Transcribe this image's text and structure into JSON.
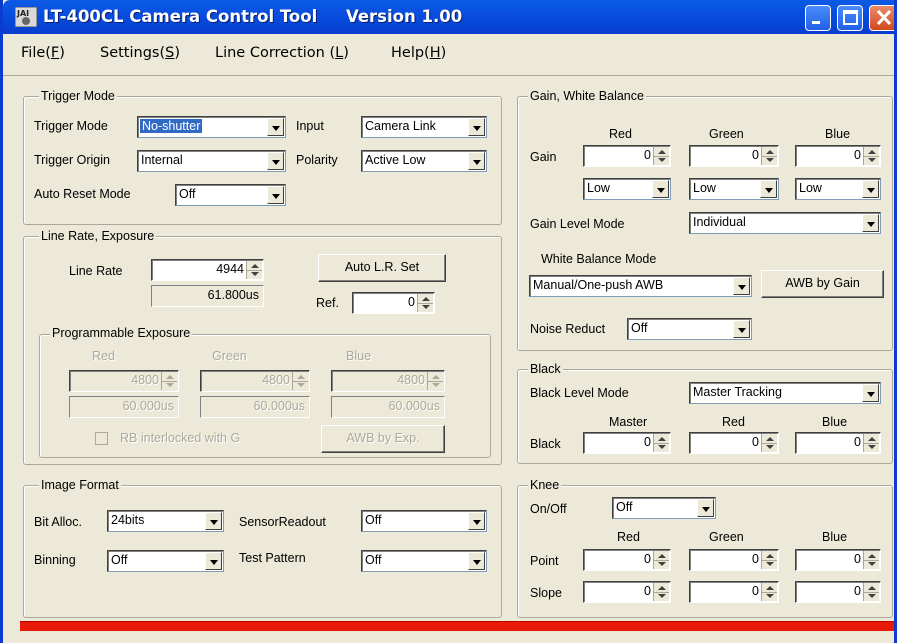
{
  "window": {
    "title": "LT-400CL Camera Control Tool     Version 1.00"
  },
  "menu": [
    {
      "text": "File(",
      "key": "F",
      "end": ")"
    },
    {
      "text": "Settings(",
      "key": "S",
      "end": ")"
    },
    {
      "text": "Line Correction (",
      "key": "L",
      "end": ")"
    },
    {
      "text": "Help(",
      "key": "H",
      "end": ")"
    }
  ],
  "trigger": {
    "title": "Trigger Mode",
    "mode_label": "Trigger Mode",
    "mode_value": "No-shutter",
    "input_label": "Input",
    "input_value": "Camera Link",
    "origin_label": "Trigger Origin",
    "origin_value": "Internal",
    "polarity_label": "Polarity",
    "polarity_value": "Active Low",
    "reset_label": "Auto Reset Mode",
    "reset_value": "Off"
  },
  "line_rate": {
    "title": "Line Rate, Exposure",
    "rate_label": "Line Rate",
    "rate_value": "4944",
    "rate_time": "61.800us",
    "auto_button": "Auto L.R. Set",
    "ref_label": "Ref.",
    "ref_value": "0"
  },
  "prog_exposure": {
    "title": "Programmable Exposure",
    "red_label": "Red",
    "green_label": "Green",
    "blue_label": "Blue",
    "red_value": "4800",
    "green_value": "4800",
    "blue_value": "4800",
    "red_time": "60.000us",
    "green_time": "60.000us",
    "blue_time": "60.000us",
    "interlock_label": "RB interlocked with G",
    "awb_button": "AWB by Exp."
  },
  "image_format": {
    "title": "Image Format",
    "bit_label": "Bit Alloc.",
    "bit_value": "24bits",
    "sensor_label": "SensorReadout",
    "sensor_value": "Off",
    "binning_label": "Binning",
    "binning_value": "Off",
    "test_label": "Test Pattern",
    "test_value": "Off"
  },
  "gain": {
    "title": "Gain, White Balance",
    "red_label": "Red",
    "green_label": "Green",
    "blue_label": "Blue",
    "gain_label": "Gain",
    "red_value": "0",
    "green_value": "0",
    "blue_value": "0",
    "red_range": "Low",
    "green_range": "Low",
    "blue_range": "Low",
    "level_mode_label": "Gain Level Mode",
    "level_mode_value": "Individual",
    "wb_mode_label": "White Balance Mode",
    "wb_mode_value": "Manual/One-push AWB",
    "awb_button": "AWB by Gain",
    "noise_label": "Noise Reduct",
    "noise_value": "Off"
  },
  "black": {
    "title": "Black",
    "mode_label": "Black Level Mode",
    "mode_value": "Master Tracking",
    "master_label": "Master",
    "red_label": "Red",
    "blue_label": "Blue",
    "row_label": "Black",
    "master_value": "0",
    "red_value": "0",
    "blue_value": "0"
  },
  "knee": {
    "title": "Knee",
    "onoff_label": "On/Off",
    "onoff_value": "Off",
    "red_label": "Red",
    "green_label": "Green",
    "blue_label": "Blue",
    "point_label": "Point",
    "slope_label": "Slope",
    "point_red": "0",
    "point_green": "0",
    "point_blue": "0",
    "slope_red": "0",
    "slope_green": "0",
    "slope_blue": "0"
  },
  "colors": {
    "title_bar": "#0a4ee0",
    "status_bar": "#e81a0a",
    "face": "#ece9d8"
  }
}
